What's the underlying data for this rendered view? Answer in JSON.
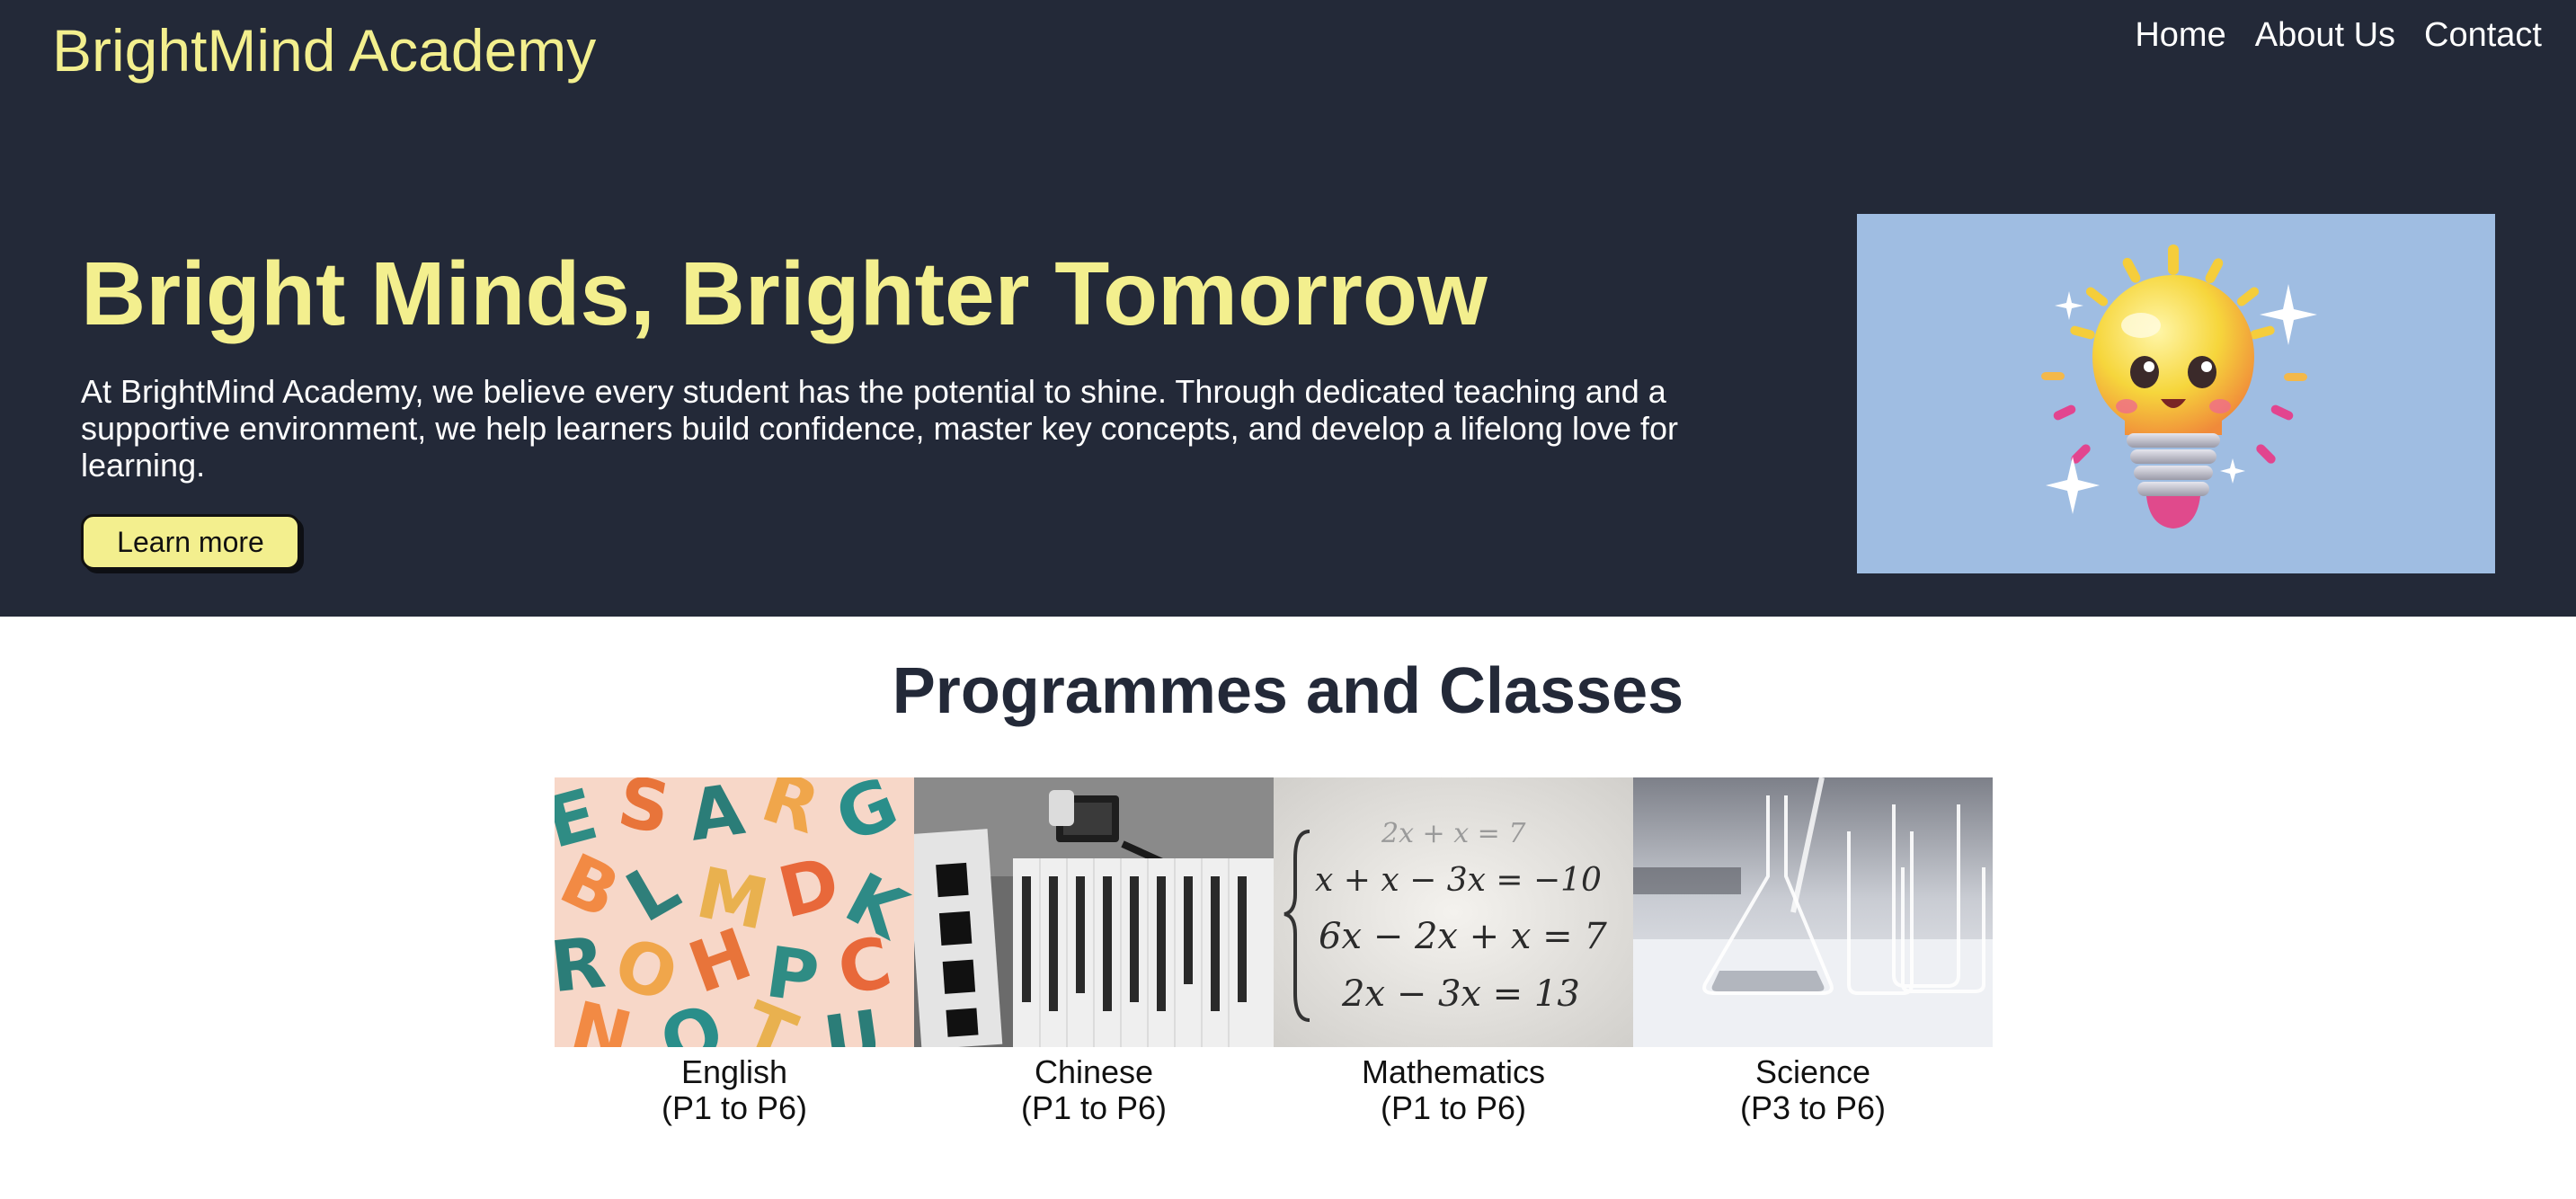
{
  "brand": "BrightMind Academy",
  "nav": [
    "Home",
    "About Us",
    "Contact"
  ],
  "hero": {
    "title": "Bright Minds, Brighter Tomorrow",
    "text": "At BrightMind Academy, we believe every student has the potential to shine. Through dedicated teaching and a supportive environment, we help learners build confidence, master key concepts, and develop a lifelong love for learning.",
    "button": "Learn more",
    "image_icon": "light-bulb-mascot"
  },
  "programmes": {
    "title": "Programmes and Classes",
    "items": [
      {
        "name": "English",
        "level": "(P1 to P6)",
        "image_icon": "alphabet-letters-photo"
      },
      {
        "name": "Chinese",
        "level": "(P1 to P6)",
        "image_icon": "chinese-calligraphy-photo"
      },
      {
        "name": "Mathematics",
        "level": "(P1 to P6)",
        "image_icon": "equations-photo"
      },
      {
        "name": "Science",
        "level": "(P3 to P6)",
        "image_icon": "lab-glassware-photo"
      }
    ]
  },
  "colors": {
    "header_bg": "#232938",
    "accent_yellow": "#f3ef8e",
    "hero_image_bg": "#9fbde2"
  }
}
